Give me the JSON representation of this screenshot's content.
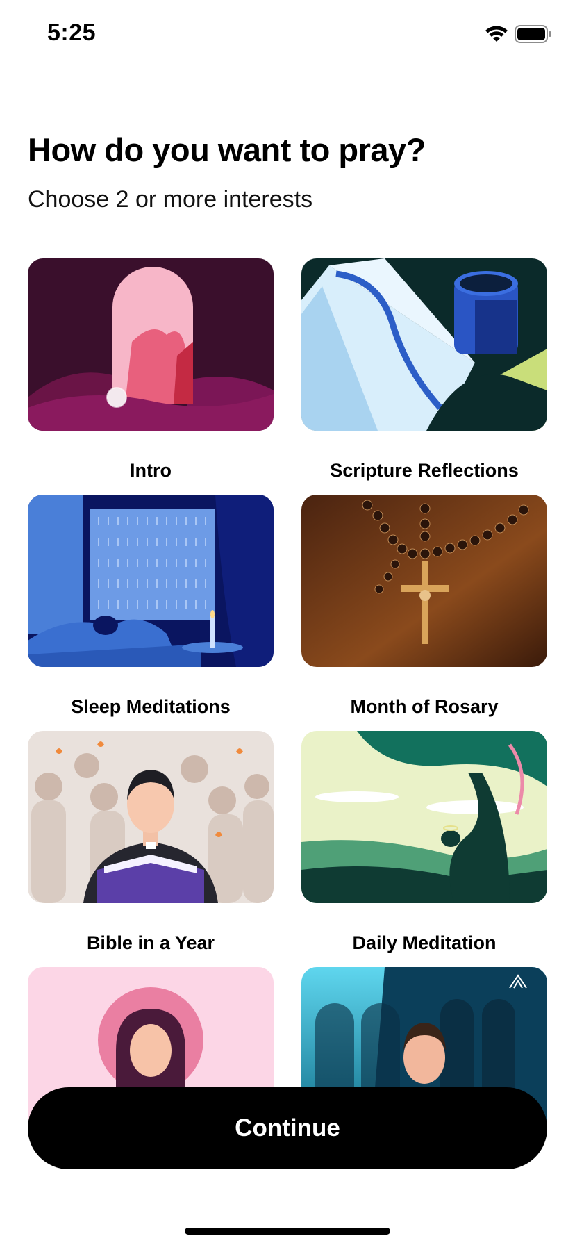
{
  "status_bar": {
    "time": "5:25",
    "icons": [
      "wifi-icon",
      "battery-icon"
    ]
  },
  "header": {
    "title": "How do you want to pray?",
    "subtitle": "Choose 2 or more interests"
  },
  "cards": [
    {
      "label": "Intro",
      "art": "arch-with-light-icon"
    },
    {
      "label": "Scripture Reflections",
      "art": "open-bible-and-mug-icon"
    },
    {
      "label": "Sleep Meditations",
      "art": "rainy-window-bedroom-icon"
    },
    {
      "label": "Month of Rosary",
      "art": "rosary-crucifix-icon"
    },
    {
      "label": "Bible in a Year",
      "art": "priest-reading-bible-icon"
    },
    {
      "label": "Daily Meditation",
      "art": "tree-landscape-icon"
    },
    {
      "label": "",
      "art": "saint-with-halo-icon"
    },
    {
      "label": "",
      "art": "man-in-cloister-icon"
    }
  ],
  "footer": {
    "continue_label": "Continue"
  },
  "colors": {
    "button": "#000000",
    "button_text": "#ffffff",
    "background": "#ffffff"
  }
}
